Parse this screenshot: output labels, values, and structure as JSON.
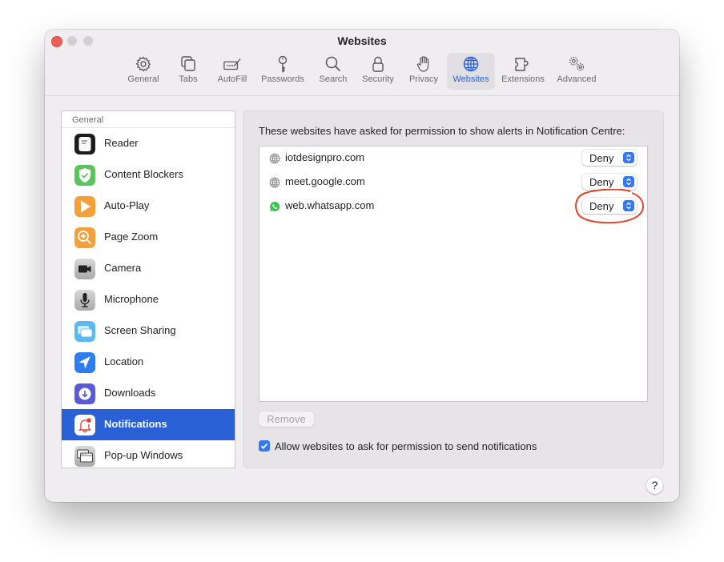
{
  "window": {
    "title": "Websites",
    "traffic_lights": [
      "close",
      "minimize",
      "zoom"
    ]
  },
  "toolbar": {
    "items": [
      {
        "label": "General",
        "icon": "gear-icon"
      },
      {
        "label": "Tabs",
        "icon": "tabs-icon"
      },
      {
        "label": "AutoFill",
        "icon": "autofill-icon"
      },
      {
        "label": "Passwords",
        "icon": "key-icon"
      },
      {
        "label": "Search",
        "icon": "magnifier-icon"
      },
      {
        "label": "Security",
        "icon": "lock-icon"
      },
      {
        "label": "Privacy",
        "icon": "hand-icon"
      },
      {
        "label": "Websites",
        "icon": "globe-icon",
        "active": true
      },
      {
        "label": "Extensions",
        "icon": "puzzle-icon"
      },
      {
        "label": "Advanced",
        "icon": "gears-icon"
      }
    ],
    "active_color": "#2a62d8"
  },
  "sidebar": {
    "section_header": "General",
    "items": [
      {
        "label": "Reader",
        "icon": "reader-icon"
      },
      {
        "label": "Content Blockers",
        "icon": "shield-check-icon"
      },
      {
        "label": "Auto-Play",
        "icon": "play-icon"
      },
      {
        "label": "Page Zoom",
        "icon": "zoom-in-icon"
      },
      {
        "label": "Camera",
        "icon": "camera-icon"
      },
      {
        "label": "Microphone",
        "icon": "microphone-icon"
      },
      {
        "label": "Screen Sharing",
        "icon": "screen-sharing-icon"
      },
      {
        "label": "Location",
        "icon": "location-arrow-icon"
      },
      {
        "label": "Downloads",
        "icon": "download-icon"
      },
      {
        "label": "Notifications",
        "icon": "bell-icon",
        "selected": true
      },
      {
        "label": "Pop-up Windows",
        "icon": "popup-windows-icon"
      }
    ],
    "selection_color": "#2a60d6"
  },
  "main": {
    "description": "These websites have asked for permission to show alerts in Notification Centre:",
    "sites": [
      {
        "name": "iotdesignpro.com",
        "icon": "globe-icon",
        "permission": "Deny"
      },
      {
        "name": "meet.google.com",
        "icon": "globe-icon",
        "permission": "Deny"
      },
      {
        "name": "web.whatsapp.com",
        "icon": "whatsapp-icon",
        "permission": "Deny",
        "annotated": true
      }
    ],
    "remove_label": "Remove",
    "allow_checkbox": {
      "label": "Allow websites to ask for permission to send notifications",
      "checked": true
    },
    "help_label": "?"
  },
  "annotation": {
    "shape": "red-circle",
    "color": "#e0462e",
    "target": "web.whatsapp.com permission popup"
  }
}
